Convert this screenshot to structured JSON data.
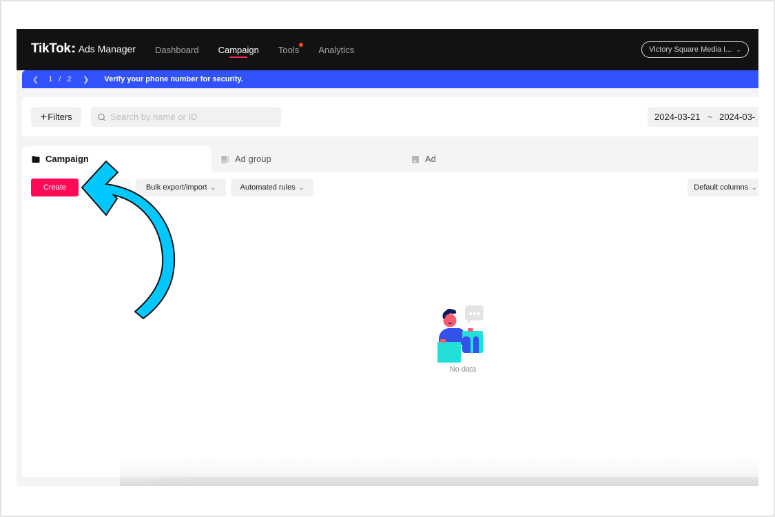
{
  "nav": {
    "logo_brand": "TikTok",
    "logo_sep": ":",
    "logo_product": "Ads Manager",
    "items": [
      {
        "label": "Dashboard",
        "active": false
      },
      {
        "label": "Campaign",
        "active": true
      },
      {
        "label": "Tools",
        "active": false,
        "badge_dot": true
      },
      {
        "label": "Analytics",
        "active": false
      }
    ],
    "account_label": "Victory Square Media I..."
  },
  "banner": {
    "page_current": "1",
    "page_sep": "/",
    "page_total": "2",
    "message": "Verify your phone number for security.",
    "color": "#3352ff"
  },
  "filters": {
    "filters_label": "Filters",
    "search_placeholder": "Search by name or ID",
    "search_value": "",
    "date_start": "2024-03-21",
    "date_sep": "~",
    "date_end": "2024-03-"
  },
  "tabs": [
    {
      "label": "Campaign",
      "icon": "folder-icon",
      "active": true
    },
    {
      "label": "Ad group",
      "icon": "ad-group-icon",
      "active": false
    },
    {
      "label": "Ad",
      "icon": "ad-icon",
      "active": false
    }
  ],
  "toolbar": {
    "create_label": "Create",
    "bulk_label": "Bulk export/import",
    "rules_label": "Automated rules",
    "columns_label": "Default columns",
    "primary_color": "#fe0a56"
  },
  "empty_state": {
    "text": "No data"
  },
  "annotation": {
    "type": "curved-arrow",
    "points_to": "create-button",
    "color": "#00c8ff"
  }
}
